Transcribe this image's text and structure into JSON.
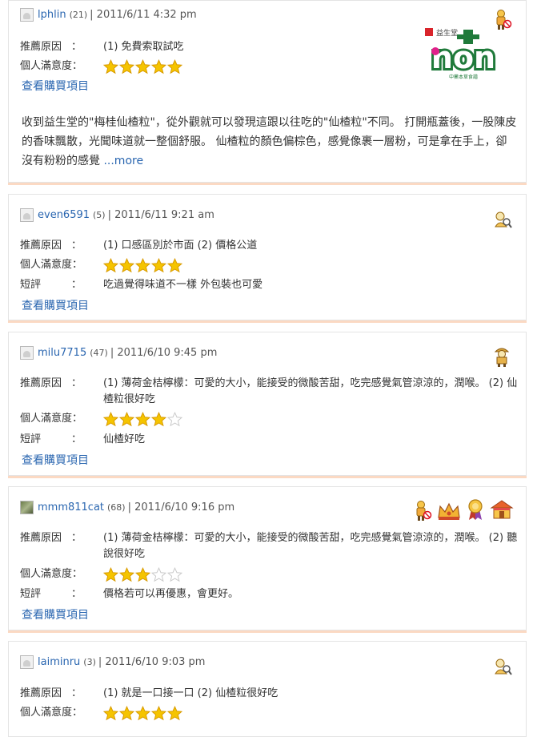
{
  "labels": {
    "reason": "推薦原因",
    "satisfaction": "個人滿意度：",
    "comment": "短評",
    "colon": "：",
    "view_purchase": "查看購買項目",
    "more": "...more"
  },
  "reviews": [
    {
      "user": "lphlin",
      "count": "(21)",
      "meta": "| 2011/6/11  4:32 pm",
      "reason": "(1) 免費索取試吃",
      "rating": 5,
      "comment": "",
      "body": "收到益生堂的\"梅桂仙楂粒\"，從外觀就可以發現這跟以往吃的\"仙楂粒\"不同。 打開瓶蓋後，一股陳皮的香味飄散，光聞味道就一整個舒服。 仙楂粒的顏色偏棕色，感覺像裹一層粉，可是拿在手上，卻沒有粉粉的感覺 "
    },
    {
      "user": "even6591",
      "count": "(5)",
      "meta": "| 2011/6/11  9:21 am",
      "reason": "(1) 口感區別於市面   (2) 價格公道",
      "rating": 5,
      "comment": "吃過覺得味道不一樣 外包裝也可愛"
    },
    {
      "user": "milu7715",
      "count": "(47)",
      "meta": "| 2011/6/10  9:45 pm",
      "reason": "(1) 薄荷金桔檸檬：可愛的大小，能接受的微酸苦甜，吃完感覺氣管涼涼的，潤喉。    (2) 仙楂粒很好吃",
      "rating": 4,
      "comment": "仙楂好吃"
    },
    {
      "user": "mmm811cat",
      "count": "(68)",
      "meta": "| 2011/6/10  9:16 pm",
      "reason": "(1) 薄荷金桔檸檬：可愛的大小，能接受的微酸苦甜，吃完感覺氣管涼涼的，潤喉。    (2) 聽說很好吃",
      "rating": 3,
      "comment": "價格若可以再優惠，會更好。"
    },
    {
      "user": "laiminru",
      "count": "(3)",
      "meta": "| 2011/6/10  9:03 pm",
      "reason": "(1) 就是一口接一口   (2) 仙楂粒很好吃",
      "rating": 5,
      "comment": ""
    }
  ],
  "logo": {
    "top_text": "益生堂",
    "main_text": "non",
    "sub_text": "中藥本草食譜"
  },
  "badges": [
    "member-icon",
    "search-person-icon",
    "explorer-icon",
    "queen-crown-icon",
    "medal-icon",
    "shop-icon"
  ],
  "colors": {
    "link": "#2a66b0",
    "star": "#f5c400",
    "logo_green": "#1f7a3a",
    "card_shadow": "#fbd9c3"
  }
}
